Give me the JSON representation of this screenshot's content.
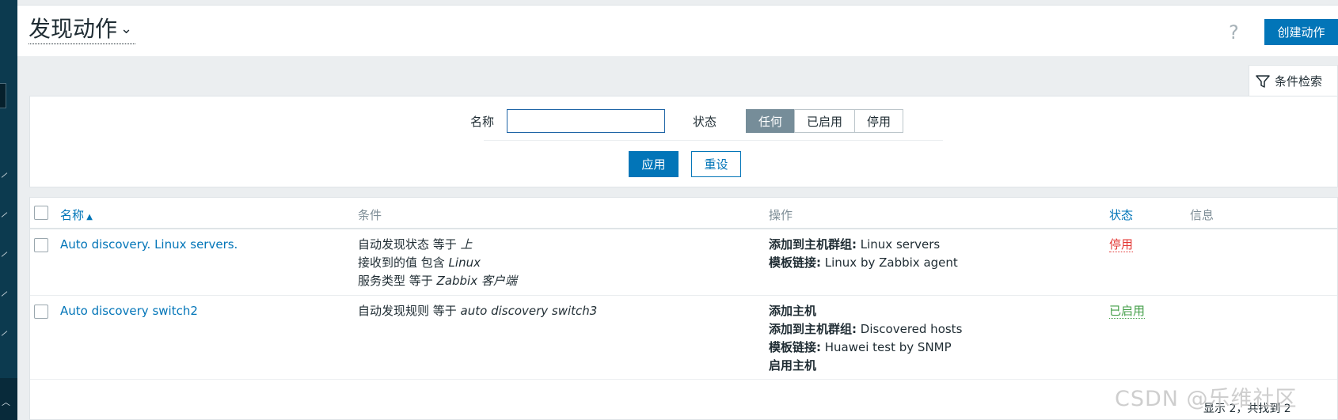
{
  "header": {
    "title": "发现动作",
    "help_icon": "?",
    "create_button": "创建动作"
  },
  "filter": {
    "tab_label": "条件检索",
    "name_label": "名称",
    "name_value": "",
    "status_label": "状态",
    "status_options": [
      "任何",
      "已启用",
      "停用"
    ],
    "status_selected": "任何",
    "apply_label": "应用",
    "reset_label": "重设"
  },
  "table": {
    "columns": {
      "name": "名称",
      "conditions": "条件",
      "operations": "操作",
      "status": "状态",
      "info": "信息"
    },
    "rows": [
      {
        "name": "Auto discovery. Linux servers.",
        "conditions": [
          {
            "text": "自动发现状态 等于 ",
            "value": "上"
          },
          {
            "text": "接收到的值 包含 ",
            "value": "Linux"
          },
          {
            "text": "服务类型 等于 ",
            "value": "Zabbix 客户端"
          }
        ],
        "operations": [
          {
            "label": "添加到主机群组:",
            "value": " Linux servers"
          },
          {
            "label": "模板链接:",
            "value": " Linux by Zabbix agent"
          }
        ],
        "status": "停用"
      },
      {
        "name": "Auto discovery switch2",
        "conditions": [
          {
            "text": "自动发现规则 等于 ",
            "value": "auto discovery switch3"
          }
        ],
        "operations": [
          {
            "label": "添加主机",
            "value": ""
          },
          {
            "label": "添加到主机群组:",
            "value": " Discovered hosts"
          },
          {
            "label": "模板链接:",
            "value": " Huawei test by SNMP"
          },
          {
            "label": "启用主机",
            "value": ""
          }
        ],
        "status": "已启用"
      }
    ],
    "footer": "显示 2，共找到 2"
  },
  "watermark": "CSDN @乐维社区",
  "colors": {
    "accent": "#0275b8",
    "disabled": "#e33734",
    "enabled": "#429e47",
    "sidebar": "#0c3a4f"
  }
}
